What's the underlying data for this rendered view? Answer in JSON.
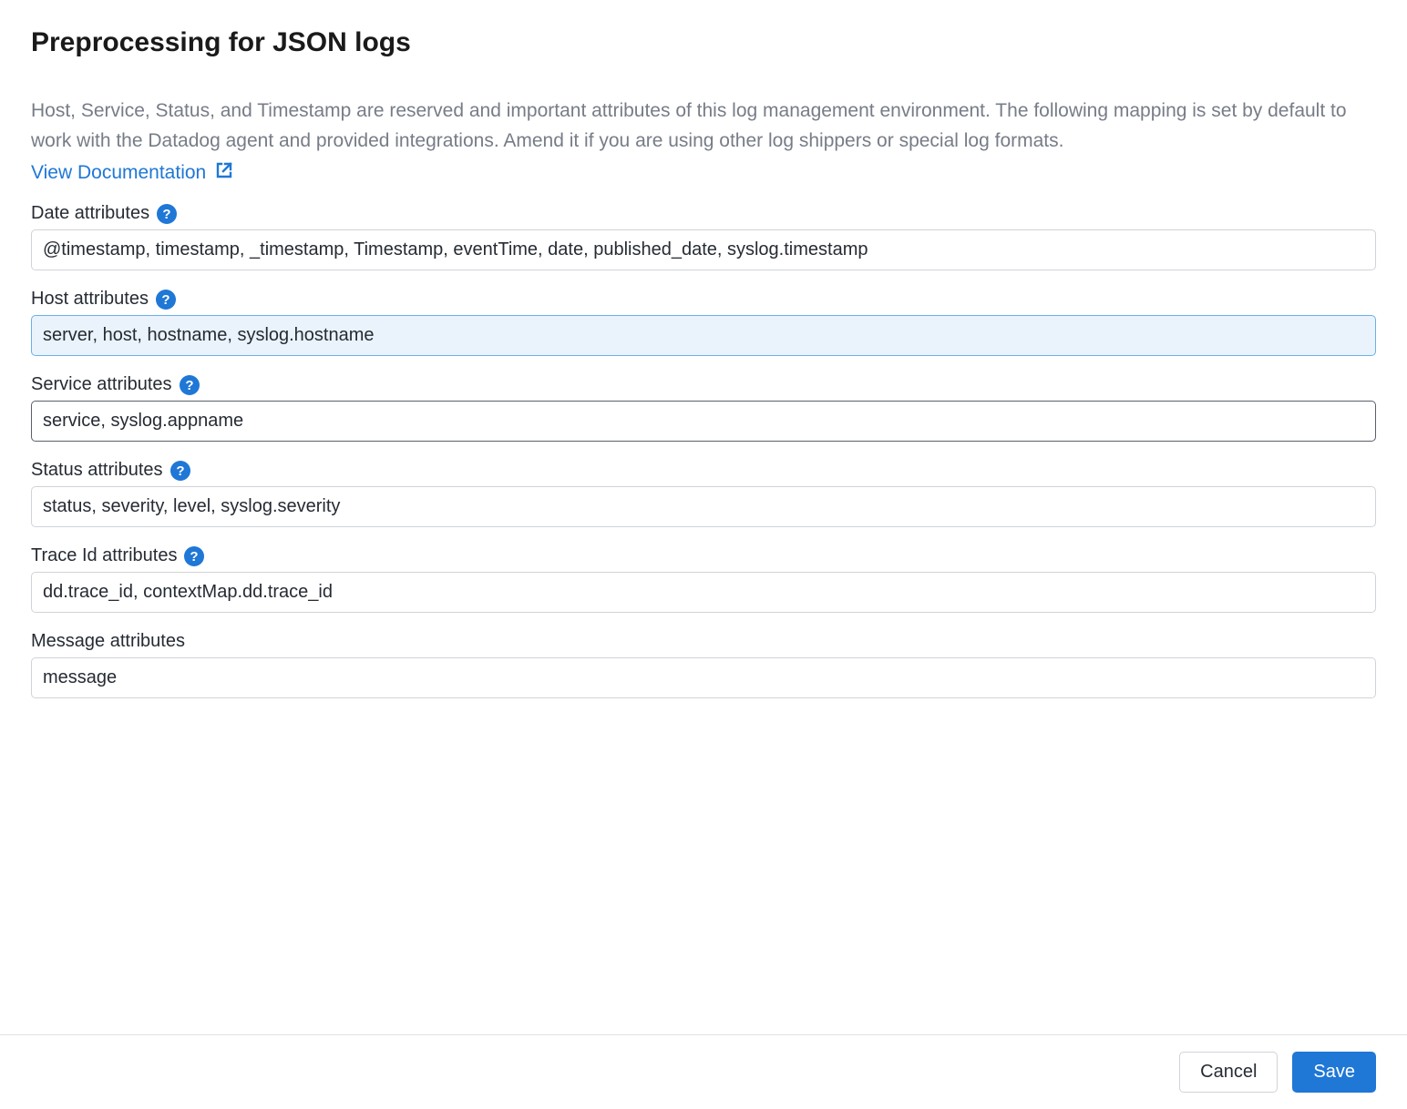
{
  "header": {
    "title": "Preprocessing for JSON logs",
    "description": "Host, Service, Status, and Timestamp are reserved and important attributes of this log management environment. The following mapping is set by default to work with the Datadog agent and provided integrations. Amend it if you are using other log shippers or special log formats.",
    "doc_link_label": "View Documentation"
  },
  "fields": {
    "date": {
      "label": "Date attributes",
      "value": "@timestamp, timestamp, _timestamp, Timestamp, eventTime, date, published_date, syslog.timestamp",
      "has_help": true
    },
    "host": {
      "label": "Host attributes",
      "value": "server, host, hostname, syslog.hostname",
      "has_help": true
    },
    "service": {
      "label": "Service attributes",
      "value": "service, syslog.appname",
      "has_help": true
    },
    "status": {
      "label": "Status attributes",
      "value": "status, severity, level, syslog.severity",
      "has_help": true
    },
    "trace_id": {
      "label": "Trace Id attributes",
      "value": "dd.trace_id, contextMap.dd.trace_id",
      "has_help": true
    },
    "message": {
      "label": "Message attributes",
      "value": "message",
      "has_help": false
    }
  },
  "footer": {
    "cancel_label": "Cancel",
    "save_label": "Save"
  }
}
